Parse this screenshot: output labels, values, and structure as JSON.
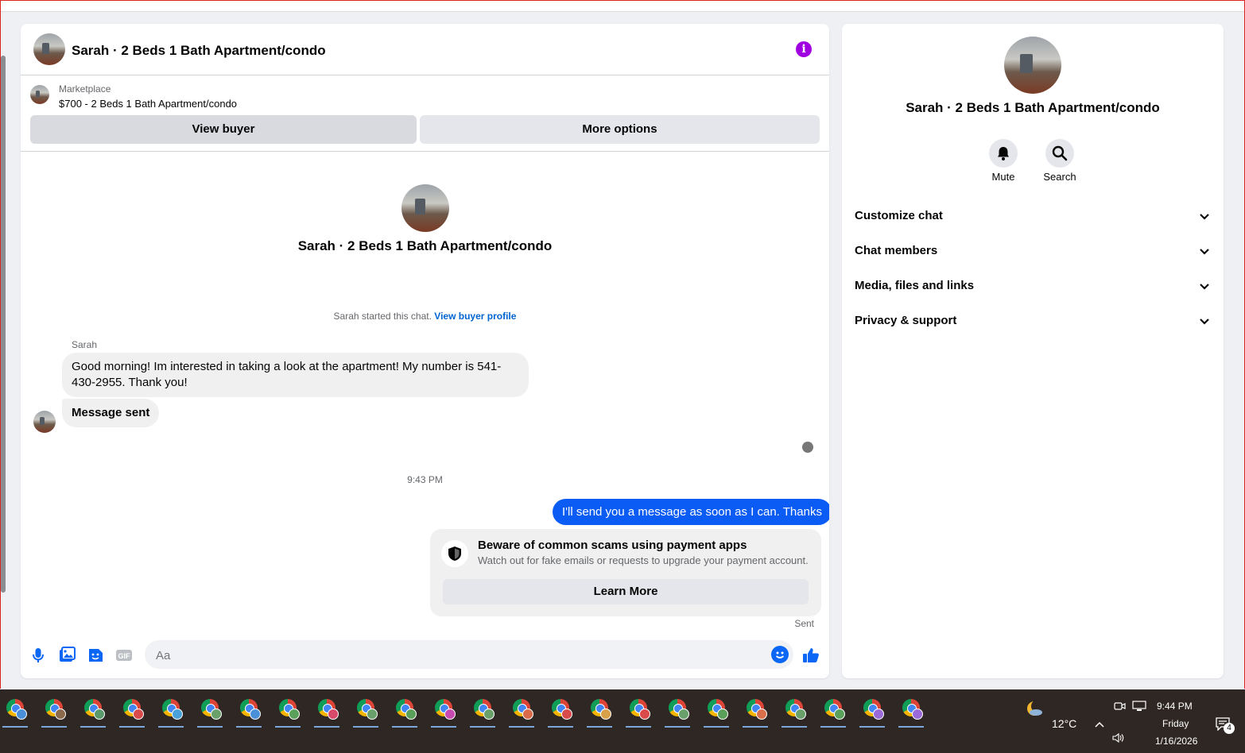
{
  "chat": {
    "header_title": "Sarah · 2 Beds 1 Bath Apartment/condo",
    "marketplace_label": "Marketplace",
    "listing": "$700 - 2 Beds 1 Bath Apartment/condo",
    "view_buyer_label": "View buyer",
    "more_options_label": "More options",
    "profile_title": "Sarah · 2 Beds 1 Bath Apartment/condo",
    "started_text": "Sarah started this chat.",
    "view_profile_link": "View buyer profile",
    "sender_name": "Sarah",
    "messages": [
      {
        "text": "Good morning! Im interested in taking a look at the apartment! My number is 541-430-2955. Thank you!"
      },
      {
        "text": "Message sent"
      }
    ],
    "timestamp": "9:43 PM",
    "outgoing_message": "I'll send you a message as soon as I can. Thanks",
    "scam_title": "Beware of common scams using payment apps",
    "scam_desc": "Watch out for fake emails or requests to upgrade your payment account.",
    "learn_more_label": "Learn More",
    "sent_status": "Sent",
    "composer_placeholder": "Aa",
    "gif_label": "GIF"
  },
  "side": {
    "title": "Sarah · 2 Beds 1 Bath Apartment/condo",
    "mute_label": "Mute",
    "search_label": "Search",
    "sections": [
      "Customize chat",
      "Chat members",
      "Media, files and links",
      "Privacy & support"
    ]
  },
  "taskbar": {
    "app_count": 24,
    "temperature": "12°C",
    "time": "9:44 PM",
    "day": "Friday",
    "date": "1/16/2026",
    "notification_count": "4"
  },
  "colors": {
    "accent": "#0a5cf5",
    "info": "#a000e0",
    "bubble_in": "#f0f0f0",
    "taskbar": "#2f2724"
  }
}
